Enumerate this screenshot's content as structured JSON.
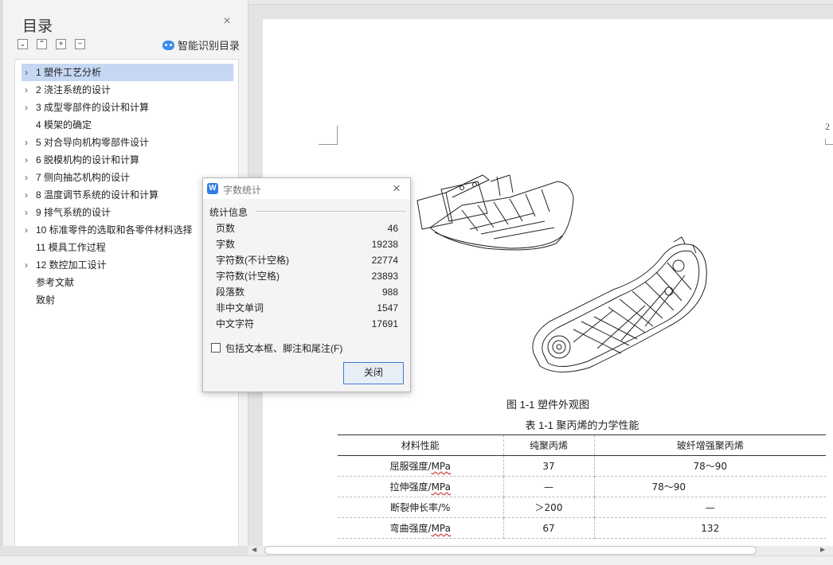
{
  "toc": {
    "title": "目录",
    "smart_label": "智能识别目录",
    "items": [
      {
        "chev": "›",
        "label": "1   塑件工艺分析",
        "selected": true
      },
      {
        "chev": "›",
        "label": "2  浇注系统的设计"
      },
      {
        "chev": "›",
        "label": "3  成型零部件的设计和计算"
      },
      {
        "chev": "",
        "label": "4    模架的确定"
      },
      {
        "chev": "›",
        "label": "5    对合导向机构零部件设计"
      },
      {
        "chev": "›",
        "label": "6    脱模机构的设计和计算"
      },
      {
        "chev": "›",
        "label": "7    侧向抽芯机构的设计"
      },
      {
        "chev": "›",
        "label": "8  温度调节系统的设计和计算"
      },
      {
        "chev": "›",
        "label": "9    排气系统的设计"
      },
      {
        "chev": "›",
        "label": "10    标准零件的选取和各零件材料选择"
      },
      {
        "chev": "",
        "label": "11    模具工作过程"
      },
      {
        "chev": "›",
        "label": "12  数控加工设计"
      },
      {
        "chev": "",
        "label": "参考文献"
      },
      {
        "chev": "",
        "label": "致射"
      }
    ]
  },
  "dialog": {
    "title": "字数统计",
    "section": "统计信息",
    "rows": [
      {
        "label": "页数",
        "value": "46"
      },
      {
        "label": "字数",
        "value": "19238"
      },
      {
        "label": "字符数(不计空格)",
        "value": "22774"
      },
      {
        "label": "字符数(计空格)",
        "value": "23893"
      },
      {
        "label": "段落数",
        "value": "988"
      },
      {
        "label": "非中文单词",
        "value": "1547"
      },
      {
        "label": "中文字符",
        "value": "17691"
      }
    ],
    "checkbox_label": "包括文本框、脚注和尾注(F)",
    "close_button": "关闭"
  },
  "document": {
    "page_number": "2",
    "figure_caption": "图 1-1 塑件外观图",
    "table_caption": "表 1-1   聚丙烯的力学性能",
    "table": {
      "headers": [
        "材料性能",
        "纯聚丙烯",
        "玻纤增强聚丙烯"
      ],
      "rows": [
        {
          "prop": "屈服强度/",
          "unit": "MPa",
          "a": "37",
          "b": "78～90"
        },
        {
          "prop": "拉伸强度/",
          "unit": "MPa",
          "a": "—",
          "b": "78～90"
        },
        {
          "prop": "断裂伸长率/%",
          "unit": "",
          "a": "＞200",
          "b": "—"
        },
        {
          "prop": "弯曲强度/",
          "unit": "MPa",
          "a": "67",
          "b": "132"
        }
      ]
    }
  }
}
